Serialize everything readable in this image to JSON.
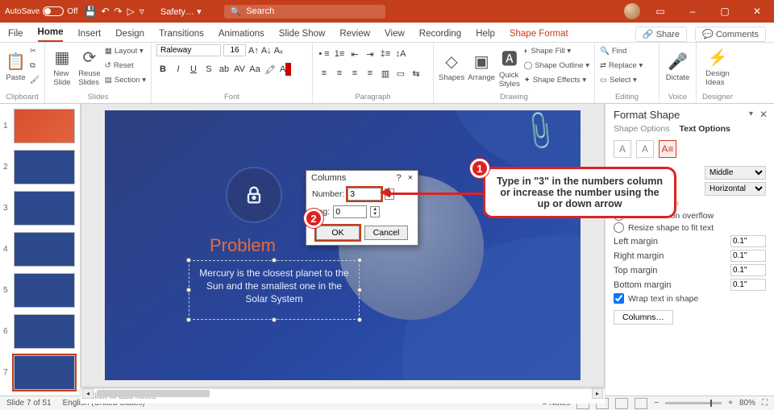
{
  "titlebar": {
    "autosave_label": "AutoSave",
    "autosave_state": "Off",
    "doc_name": "Safety… ▾",
    "search_placeholder": "Search"
  },
  "tabs": {
    "file": "File",
    "home": "Home",
    "insert": "Insert",
    "design": "Design",
    "transitions": "Transitions",
    "animations": "Animations",
    "slideshow": "Slide Show",
    "review": "Review",
    "view": "View",
    "recording": "Recording",
    "help": "Help",
    "shapeformat": "Shape Format",
    "share": "Share",
    "comments": "Comments"
  },
  "ribbon": {
    "clipboard": {
      "paste": "Paste",
      "label": "Clipboard"
    },
    "slides": {
      "new": "New\nSlide",
      "reuse": "Reuse\nSlides",
      "layout": "Layout ▾",
      "reset": "Reset",
      "section": "Section ▾",
      "label": "Slides"
    },
    "font": {
      "family": "Raleway",
      "size": "16",
      "label": "Font"
    },
    "paragraph": {
      "label": "Paragraph"
    },
    "drawing": {
      "shapes": "Shapes",
      "arrange": "Arrange",
      "quick": "Quick\nStyles",
      "fill": "Shape Fill ▾",
      "outline": "Shape Outline ▾",
      "effects": "Shape Effects ▾",
      "label": "Drawing"
    },
    "editing": {
      "find": "Find",
      "replace": "Replace ▾",
      "select": "Select ▾",
      "label": "Editing"
    },
    "voice": {
      "dictate": "Dictate",
      "label": "Voice"
    },
    "designer": {
      "ideas": "Design\nIdeas",
      "label": "Designer"
    }
  },
  "thumbs": [
    1,
    2,
    3,
    4,
    5,
    6,
    7
  ],
  "slide": {
    "title": "Problem",
    "body": "Mercury is the closest planet to the Sun and the smallest one in the Solar System"
  },
  "dialog": {
    "title": "Columns",
    "number_label": "Number:",
    "number_value": "3",
    "spacing_label": "cing:",
    "spacing_value": "0",
    "ok": "OK",
    "cancel": "Cancel",
    "help": "?",
    "close": "×"
  },
  "callouts": {
    "one": "Type in \"3\" in the numbers column or increase the number using the up or down arrow"
  },
  "notes_placeholder": "Click to add notes",
  "fspane": {
    "title": "Format Shape",
    "shape_opts": "Shape Options",
    "text_opts": "Text Options",
    "valign_label": "",
    "valign_value": "Middle",
    "dir_value": "Horizontal",
    "opt_donot": "Do not Autofit",
    "opt_shrink": "Shrink text on overflow",
    "opt_resize": "Resize shape to fit text",
    "lm": "Left margin",
    "rm": "Right margin",
    "tm": "Top margin",
    "bm": "Bottom margin",
    "margin_val": "0.1\"",
    "wrap": "Wrap text in shape",
    "columns": "Columns…"
  },
  "status": {
    "slide": "Slide 7 of 51",
    "lang": "English (United States)",
    "notes": "Notes",
    "zoom": "80%"
  }
}
